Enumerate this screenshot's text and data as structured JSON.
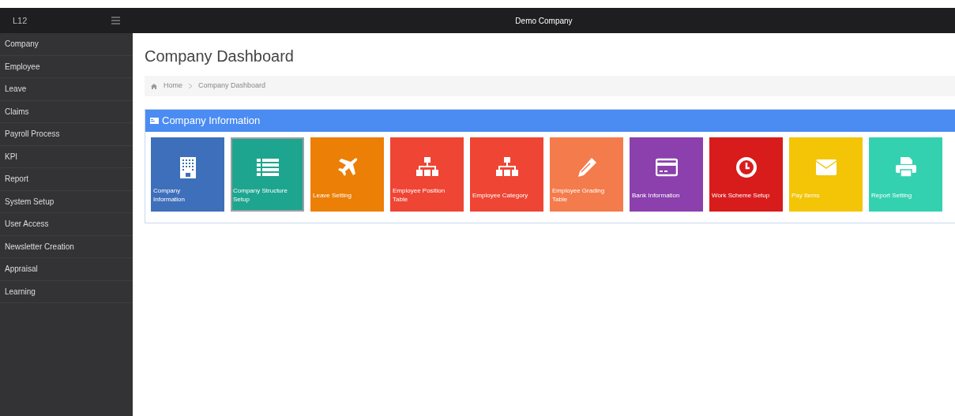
{
  "topbar": {
    "brand": "L12",
    "title": "Demo Company"
  },
  "sidebar": {
    "items": [
      {
        "label": "Company"
      },
      {
        "label": "Employee"
      },
      {
        "label": "Leave"
      },
      {
        "label": "Claims"
      },
      {
        "label": "Payroll Process"
      },
      {
        "label": "KPI"
      },
      {
        "label": "Report"
      },
      {
        "label": "System Setup"
      },
      {
        "label": "User Access"
      },
      {
        "label": "Newsletter Creation"
      },
      {
        "label": "Appraisal"
      },
      {
        "label": "Learning"
      }
    ]
  },
  "page": {
    "title": "Company Dashboard",
    "breadcrumb": [
      "Home",
      "Company Dashboard"
    ]
  },
  "panel": {
    "title": "Company Information",
    "tiles": [
      {
        "label": "Company Information",
        "color": "#3e6fba",
        "selected": false
      },
      {
        "label": "Company Structure Setup",
        "color": "#1ea58f",
        "selected": true
      },
      {
        "label": "Leave Setting",
        "color": "#ec7f06",
        "selected": false
      },
      {
        "label": "Employee Position Table",
        "color": "#ef4534",
        "selected": false
      },
      {
        "label": "Employee Category",
        "color": "#ef4534",
        "selected": false
      },
      {
        "label": "Employee Grading Table",
        "color": "#f47b4b",
        "selected": false
      },
      {
        "label": "Bank Information",
        "color": "#8b40ad",
        "selected": false
      },
      {
        "label": "Work Scheme Setup",
        "color": "#d81c1c",
        "selected": false
      },
      {
        "label": "Pay Items",
        "color": "#f3c506",
        "selected": false
      },
      {
        "label": "Report Setting",
        "color": "#34d1b0",
        "selected": false
      }
    ]
  }
}
